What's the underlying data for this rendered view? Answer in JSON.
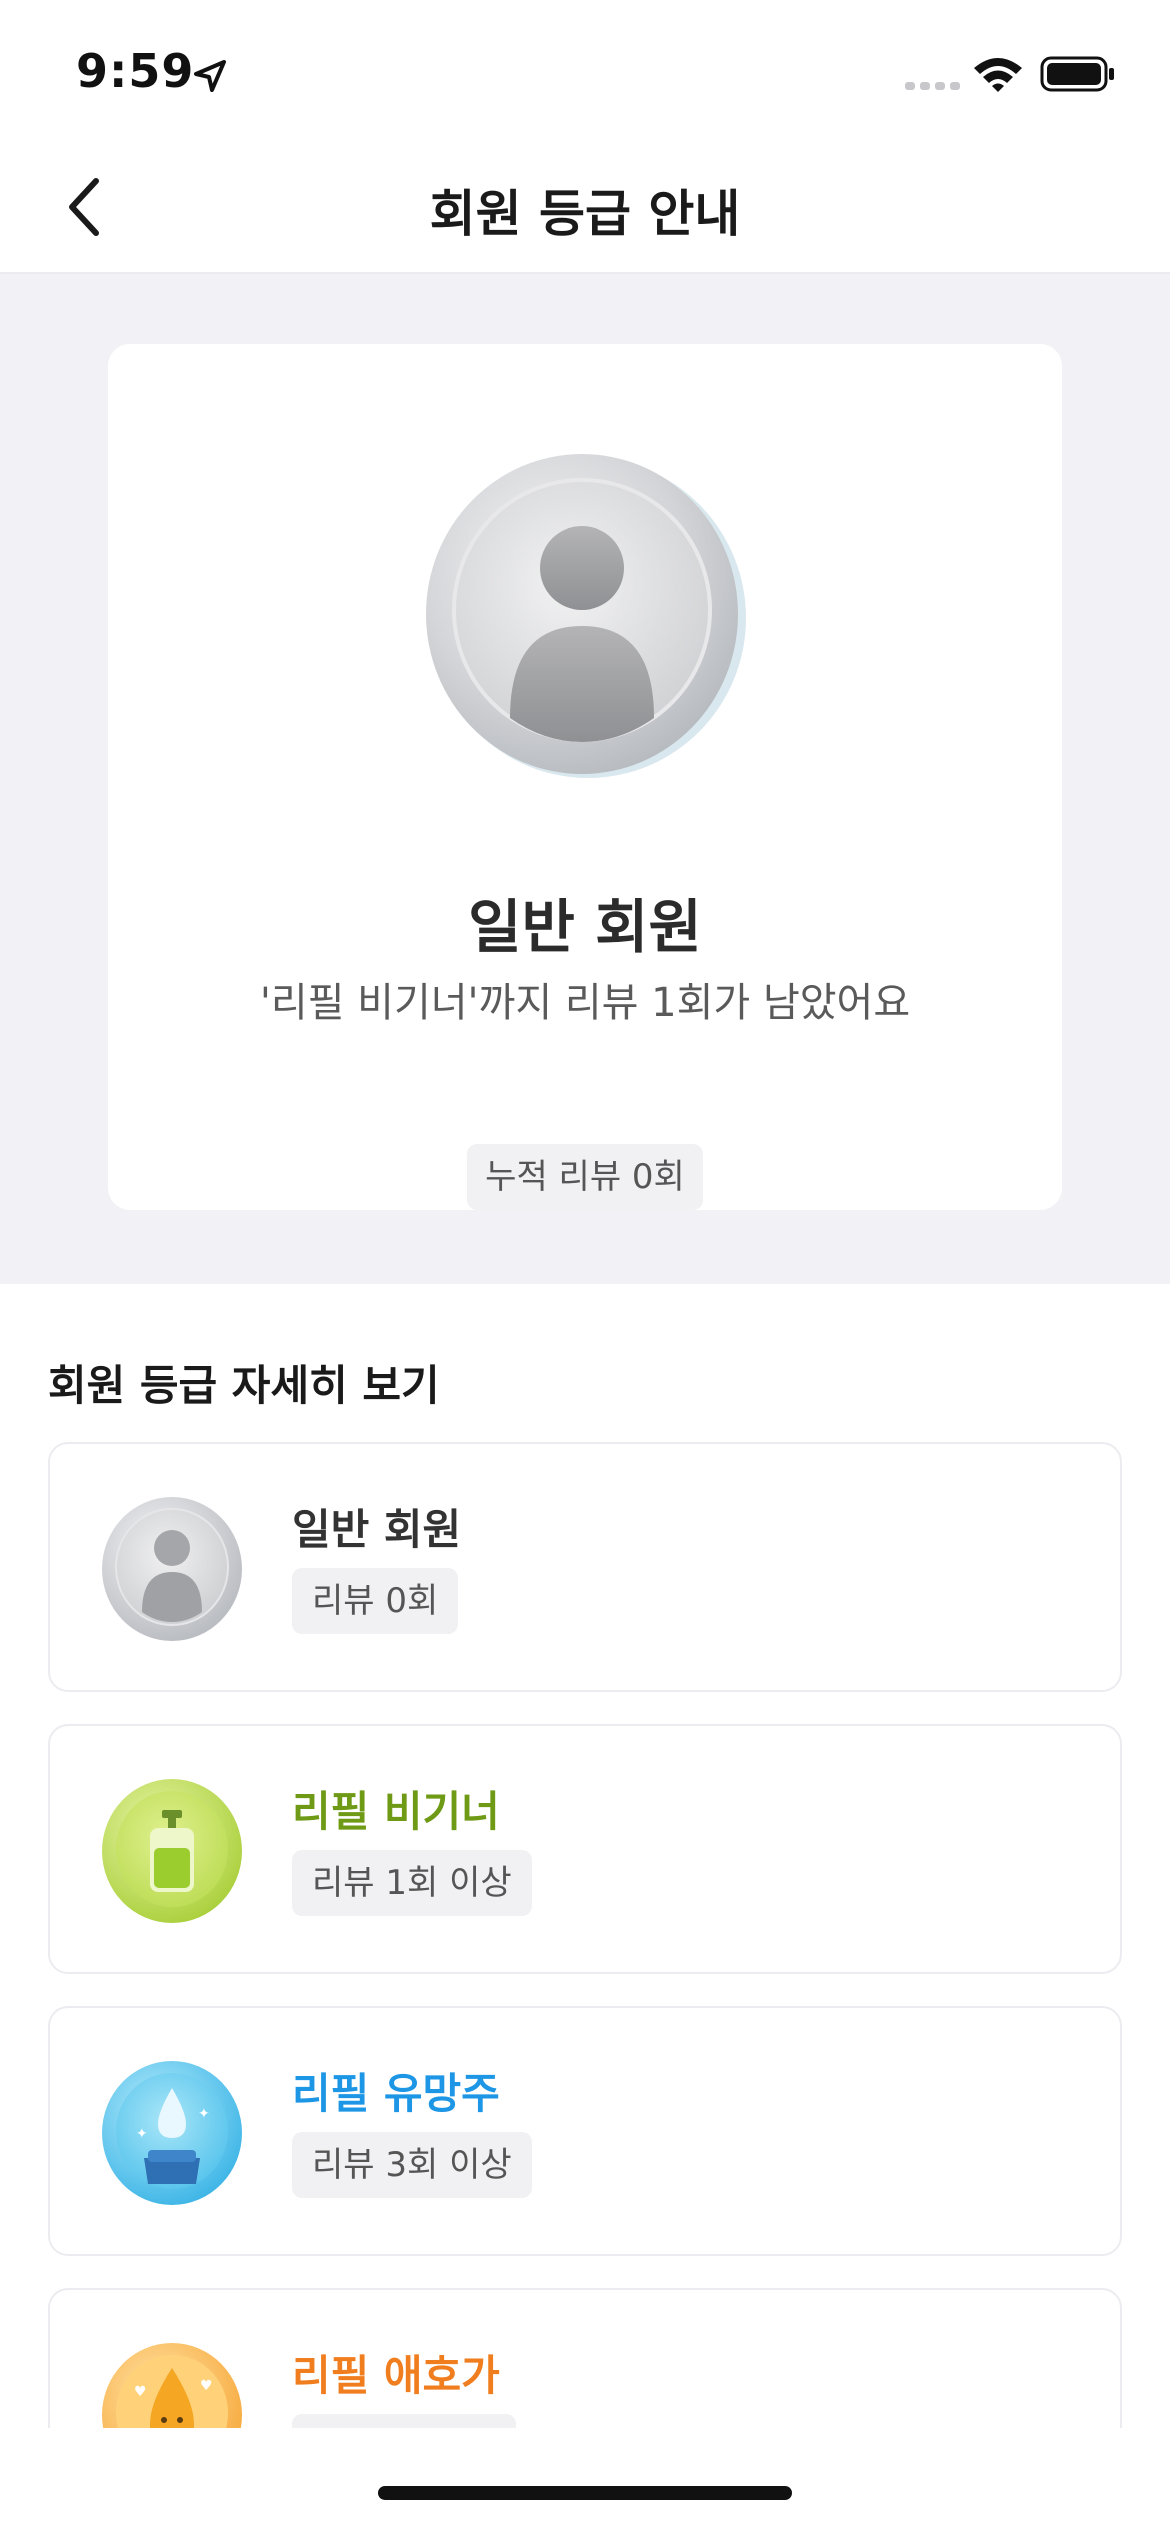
{
  "status_bar": {
    "time": "9:59",
    "icons": [
      "location-arrow-icon",
      "cellular-signal-icon",
      "wifi-icon",
      "battery-icon"
    ]
  },
  "nav": {
    "title": "회원 등급 안내",
    "back_icon": "chevron-left-icon"
  },
  "current_grade": {
    "badge_icon": "person-badge-icon",
    "name": "일반 회원",
    "description": "'리필 비기너'까지 리뷰 1회가 남았어요",
    "review_count_label": "누적 리뷰 0회"
  },
  "details": {
    "title": "회원 등급 자세히 보기",
    "grades": [
      {
        "name": "일반 회원",
        "requirement": "리뷰 0회",
        "icon": "person-badge-icon",
        "color": "#333333"
      },
      {
        "name": "리필 비기너",
        "requirement": "리뷰 1회 이상",
        "icon": "refill-bottle-badge-icon",
        "color": "#6e9a16"
      },
      {
        "name": "리필 유망주",
        "requirement": "리뷰 3회 이상",
        "icon": "water-drop-badge-icon",
        "color": "#1e96e6"
      },
      {
        "name": "리필 애호가",
        "requirement": "",
        "icon": "smiling-drop-badge-icon",
        "color": "#f07d1e"
      }
    ]
  },
  "colors": {
    "hero_background": "#f2f2f6",
    "pill_background": "#f1f1f4",
    "card_border": "#ececf0"
  }
}
